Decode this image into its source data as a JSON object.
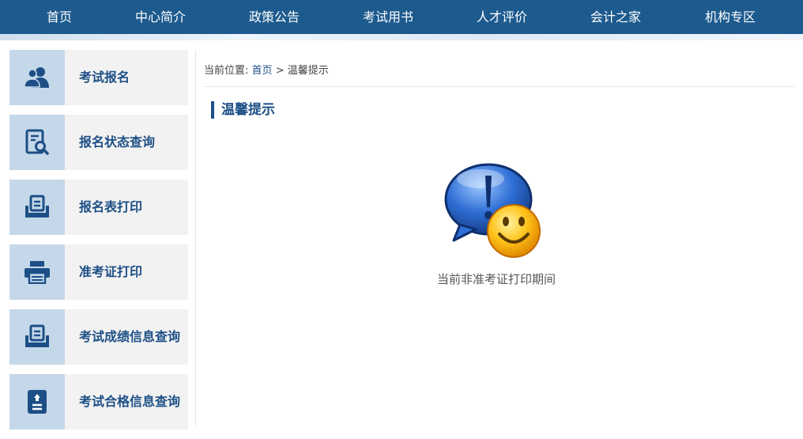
{
  "nav": {
    "items": [
      {
        "label": "首页"
      },
      {
        "label": "中心简介"
      },
      {
        "label": "政策公告"
      },
      {
        "label": "考试用书"
      },
      {
        "label": "人才评价"
      },
      {
        "label": "会计之家"
      },
      {
        "label": "机构专区"
      }
    ]
  },
  "sidebar": {
    "items": [
      {
        "label": "考试报名",
        "icon": "users-icon"
      },
      {
        "label": "报名状态查询",
        "icon": "document-search-icon"
      },
      {
        "label": "报名表打印",
        "icon": "form-tray-icon"
      },
      {
        "label": "准考证打印",
        "icon": "printer-icon"
      },
      {
        "label": "考试成绩信息查询",
        "icon": "score-tray-icon"
      },
      {
        "label": "考试合格信息查询",
        "icon": "certificate-icon"
      }
    ]
  },
  "breadcrumb": {
    "prefix": "当前位置:",
    "home": "首页",
    "separator": ">",
    "current": "温馨提示"
  },
  "main": {
    "title": "温馨提示",
    "notice_icon": "speech-bubble-smiley-icon",
    "message": "当前非准考证打印期间"
  },
  "colors": {
    "nav_bg": "#1d5a8e",
    "accent": "#1d4f86",
    "icon_bg": "#c5d8ea",
    "item_bg": "#f2f2f2"
  }
}
